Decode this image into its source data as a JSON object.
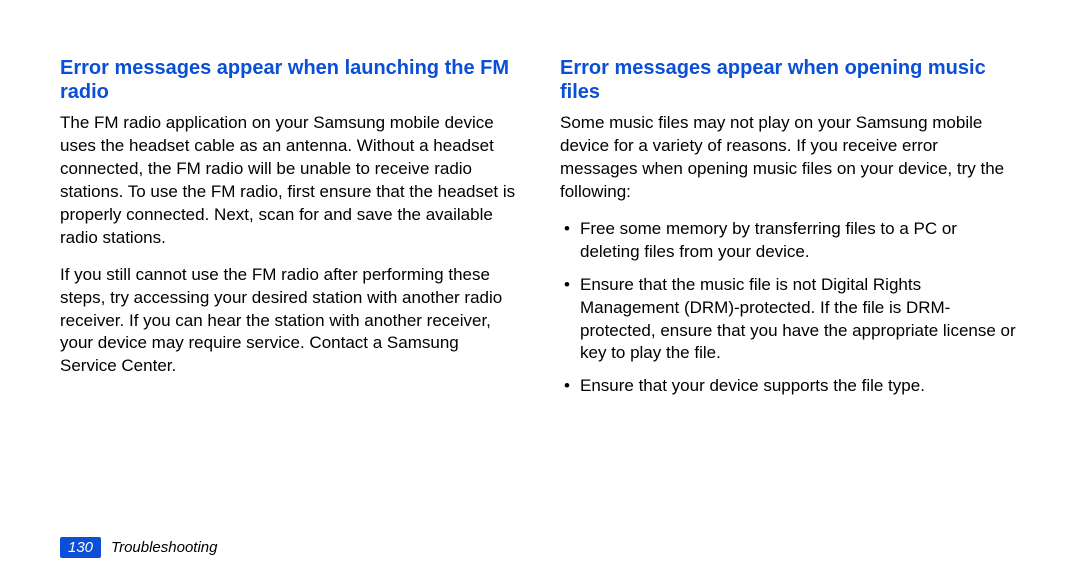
{
  "left": {
    "title": "Error messages appear when launching the FM radio",
    "p1": "The FM radio application on your Samsung mobile device uses the headset cable as an antenna. Without a headset connected, the FM radio will be unable to receive radio stations. To use the FM radio, first ensure that the headset is properly connected. Next, scan for and save the available radio stations.",
    "p2": "If you still cannot use the FM radio after performing these steps, try accessing your desired station with another radio receiver. If you can hear the station with another receiver, your device may require service. Contact a Samsung Service Center."
  },
  "right": {
    "title": "Error messages appear when opening music files",
    "intro": "Some music files may not play on your Samsung mobile device for a variety of reasons. If you receive error messages when opening music files on your device, try the following:",
    "bullets": [
      "Free some memory by transferring files to a PC or deleting files from your device.",
      "Ensure that the music file is not Digital Rights Management (DRM)-protected. If the file is DRM-protected, ensure that you have the appropriate license or key to play the file.",
      "Ensure that your device supports the file type."
    ]
  },
  "footer": {
    "page_number": "130",
    "section": "Troubleshooting"
  }
}
